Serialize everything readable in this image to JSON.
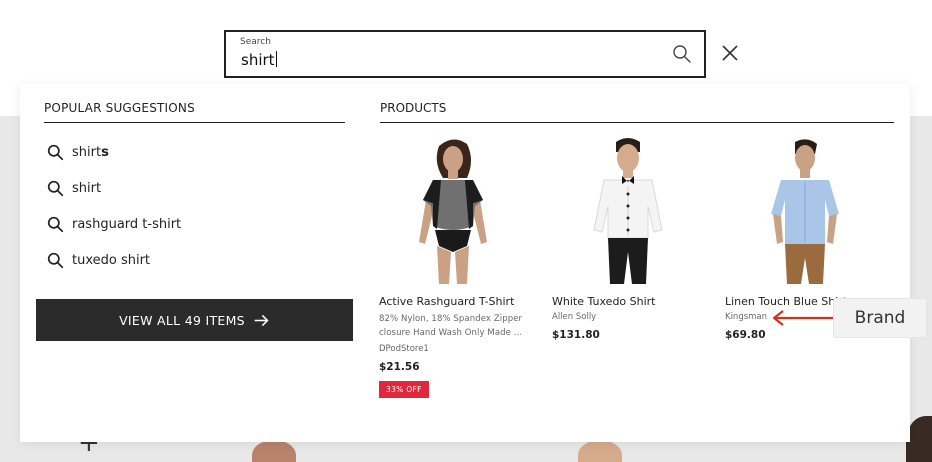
{
  "search": {
    "label": "Search",
    "value": "shirt"
  },
  "suggestions": {
    "title": "POPULAR SUGGESTIONS",
    "items": [
      {
        "base": "shirt",
        "suffix": "s"
      },
      {
        "base": "shirt",
        "suffix": ""
      },
      {
        "base": "rashguard t-shirt",
        "suffix": ""
      },
      {
        "base": "tuxedo shirt",
        "suffix": ""
      }
    ]
  },
  "view_all": {
    "label": "VIEW ALL 49 ITEMS"
  },
  "products": {
    "title": "PRODUCTS",
    "items": [
      {
        "name": "Active Rashguard T-Shirt",
        "desc": "82% Nylon, 18% Spandex Zipper closure Hand Wash Only Made ...",
        "brand": "DPodStore1",
        "price": "$21.56",
        "badge": "33% OFF"
      },
      {
        "name": "White Tuxedo Shirt",
        "brand": "Allen Solly",
        "price": "$131.80"
      },
      {
        "name": "Linen Touch Blue Shirt",
        "brand": "Kingsman",
        "price": "$69.80"
      }
    ]
  },
  "annotation": {
    "label": "Brand",
    "color": "#d0331b"
  },
  "colors": {
    "accent_dark": "#2b2b2b",
    "badge_red": "#e0283c",
    "backdrop_gray": "#e8e8e8"
  },
  "icons": {
    "search": "search-icon",
    "close": "close-icon",
    "arrow": "arrow-right-icon"
  }
}
